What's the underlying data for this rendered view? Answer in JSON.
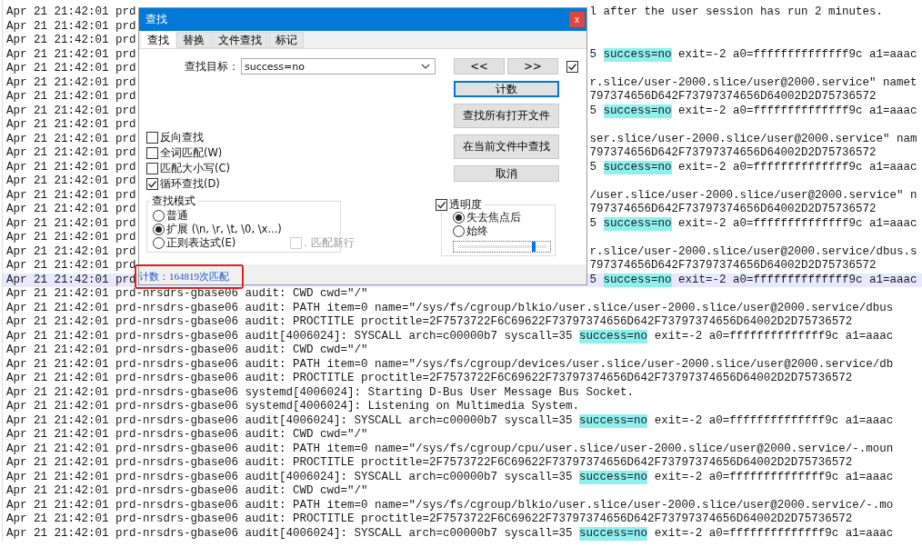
{
  "log_lines": [
    {
      "start": [
        {
          "text": "Apr 21 21:42:01 prd",
          "match": false
        }
      ],
      "end": [
        {
          "text": "l after the user session has run 2 minutes.",
          "match": false
        }
      ],
      "current": false
    },
    {
      "start": [
        {
          "text": "Apr 21 21:42:01 prd",
          "match": false
        }
      ],
      "current": false
    },
    {
      "start": [
        {
          "text": "Apr 21 21:42:01 prd",
          "match": false
        }
      ],
      "current": false
    },
    {
      "start": [
        {
          "text": "Apr 21 21:42:01 prd",
          "match": false
        }
      ],
      "end": [
        {
          "text": "5 ",
          "match": false
        },
        {
          "text": "success=no",
          "match": true
        },
        {
          "text": " exit=-2 a0=ffffffffffffff9c a1=aaac",
          "match": false
        }
      ],
      "current": false
    },
    {
      "start": [
        {
          "text": "Apr 21 21:42:01 prd",
          "match": false
        }
      ],
      "current": false
    },
    {
      "start": [
        {
          "text": "Apr 21 21:42:01 prd",
          "match": false
        }
      ],
      "end": [
        {
          "text": "r.slice/user-2000.slice/user@2000.service\" namet",
          "match": false
        }
      ],
      "current": false
    },
    {
      "start": [
        {
          "text": "Apr 21 21:42:01 prd",
          "match": false
        }
      ],
      "end": [
        {
          "text": "797374656D642F73797374656D64002D2D75736572",
          "match": false
        }
      ],
      "current": false
    },
    {
      "start": [
        {
          "text": "Apr 21 21:42:01 prd",
          "match": false
        }
      ],
      "end": [
        {
          "text": "5 ",
          "match": false
        },
        {
          "text": "success=no",
          "match": true
        },
        {
          "text": " exit=-2 a0=ffffffffffffff9c a1=aaac",
          "match": false
        }
      ],
      "current": false
    },
    {
      "start": [
        {
          "text": "Apr 21 21:42:01 prd",
          "match": false
        }
      ],
      "current": false
    },
    {
      "start": [
        {
          "text": "Apr 21 21:42:01 prd",
          "match": false
        }
      ],
      "end": [
        {
          "text": "ser.slice/user-2000.slice/user@2000.service\" nam",
          "match": false
        }
      ],
      "current": false
    },
    {
      "start": [
        {
          "text": "Apr 21 21:42:01 prd",
          "match": false
        }
      ],
      "end": [
        {
          "text": "797374656D642F73797374656D64002D2D75736572",
          "match": false
        }
      ],
      "current": false
    },
    {
      "start": [
        {
          "text": "Apr 21 21:42:01 prd",
          "match": false
        }
      ],
      "end": [
        {
          "text": "5 ",
          "match": false
        },
        {
          "text": "success=no",
          "match": true
        },
        {
          "text": " exit=-2 a0=ffffffffffffff9c a1=aaac",
          "match": false
        }
      ],
      "current": false
    },
    {
      "start": [
        {
          "text": "Apr 21 21:42:01 prd",
          "match": false
        }
      ],
      "current": false
    },
    {
      "start": [
        {
          "text": "Apr 21 21:42:01 prd",
          "match": false
        }
      ],
      "end": [
        {
          "text": "/user.slice/user-2000.slice/user@2000.service\" n",
          "match": false
        }
      ],
      "current": false
    },
    {
      "start": [
        {
          "text": "Apr 21 21:42:01 prd",
          "match": false
        }
      ],
      "end": [
        {
          "text": "797374656D642F73797374656D64002D2D75736572",
          "match": false
        }
      ],
      "current": false
    },
    {
      "start": [
        {
          "text": "Apr 21 21:42:01 prd",
          "match": false
        }
      ],
      "end": [
        {
          "text": "5 ",
          "match": false
        },
        {
          "text": "success=no",
          "match": true
        },
        {
          "text": " exit=-2 a0=ffffffffffffff9c a1=aaac",
          "match": false
        }
      ],
      "current": false
    },
    {
      "start": [
        {
          "text": "Apr 21 21:42:01 prd",
          "match": false
        }
      ],
      "current": false
    },
    {
      "start": [
        {
          "text": "Apr 21 21:42:01 prd",
          "match": false
        }
      ],
      "end": [
        {
          "text": "r.slice/user-2000.slice/user@2000.service/dbus.s",
          "match": false
        }
      ],
      "current": false
    },
    {
      "start": [
        {
          "text": "Apr 21 21:42:01 prd",
          "match": false
        }
      ],
      "end": [
        {
          "text": "797374656D642F73797374656D64002D2D75736572",
          "match": false
        }
      ],
      "current": false
    },
    {
      "start": [
        {
          "text": "Apr 21 21:42:01 prd",
          "match": false
        }
      ],
      "end": [
        {
          "text": "5 ",
          "match": false
        },
        {
          "text": "success=no",
          "match": true
        },
        {
          "text": " exit=-2 a0=ffffffffffffff9c a1=aaac",
          "match": false
        }
      ],
      "current": true
    },
    {
      "start": [
        {
          "text": "Apr 21 21:42:01 prd-nrsdrs-gbase06 audit: CWD cwd=\"/\"",
          "match": false
        }
      ],
      "current": false
    },
    {
      "start": [
        {
          "text": "Apr 21 21:42:01 prd-nrsdrs-gbase06 audit: PATH item=0 name=\"/sys/fs/cgroup/blkio/user.slice/user-2000.slice/user@2000.service/dbus",
          "match": false
        }
      ],
      "current": false
    },
    {
      "start": [
        {
          "text": "Apr 21 21:42:01 prd-nrsdrs-gbase06 audit: PROCTITLE proctitle=2F7573722F6C69622F73797374656D642F73797374656D64002D2D75736572",
          "match": false
        }
      ],
      "current": false
    },
    {
      "start": [
        {
          "text": "Apr 21 21:42:01 prd-nrsdrs-gbase06 audit[4006024]: SYSCALL arch=c00000b7 syscall=35 ",
          "match": false
        },
        {
          "text": "success=no",
          "match": true
        },
        {
          "text": " exit=-2 a0=ffffffffffffff9c a1=aaac",
          "match": false
        }
      ],
      "current": false
    },
    {
      "start": [
        {
          "text": "Apr 21 21:42:01 prd-nrsdrs-gbase06 audit: CWD cwd=\"/\"",
          "match": false
        }
      ],
      "current": false
    },
    {
      "start": [
        {
          "text": "Apr 21 21:42:01 prd-nrsdrs-gbase06 audit: PATH item=0 name=\"/sys/fs/cgroup/devices/user.slice/user-2000.slice/user@2000.service/db",
          "match": false
        }
      ],
      "current": false
    },
    {
      "start": [
        {
          "text": "Apr 21 21:42:01 prd-nrsdrs-gbase06 audit: PROCTITLE proctitle=2F7573722F6C69622F73797374656D642F73797374656D64002D2D75736572",
          "match": false
        }
      ],
      "current": false
    },
    {
      "start": [
        {
          "text": "Apr 21 21:42:01 prd-nrsdrs-gbase06 systemd[4006024]: Starting D-Bus User Message Bus Socket.",
          "match": false
        }
      ],
      "current": false
    },
    {
      "start": [
        {
          "text": "Apr 21 21:42:01 prd-nrsdrs-gbase06 systemd[4006024]: Listening on Multimedia System.",
          "match": false
        }
      ],
      "current": false
    },
    {
      "start": [
        {
          "text": "Apr 21 21:42:01 prd-nrsdrs-gbase06 audit[4006024]: SYSCALL arch=c00000b7 syscall=35 ",
          "match": false
        },
        {
          "text": "success=no",
          "match": true
        },
        {
          "text": " exit=-2 a0=ffffffffffffff9c a1=aaac",
          "match": false
        }
      ],
      "current": false
    },
    {
      "start": [
        {
          "text": "Apr 21 21:42:01 prd-nrsdrs-gbase06 audit: CWD cwd=\"/\"",
          "match": false
        }
      ],
      "current": false
    },
    {
      "start": [
        {
          "text": "Apr 21 21:42:01 prd-nrsdrs-gbase06 audit: PATH item=0 name=\"/sys/fs/cgroup/cpu/user.slice/user-2000.slice/user@2000.service/-.moun",
          "match": false
        }
      ],
      "current": false
    },
    {
      "start": [
        {
          "text": "Apr 21 21:42:01 prd-nrsdrs-gbase06 audit: PROCTITLE proctitle=2F7573722F6C69622F73797374656D642F73797374656D64002D2D75736572",
          "match": false
        }
      ],
      "current": false
    },
    {
      "start": [
        {
          "text": "Apr 21 21:42:01 prd-nrsdrs-gbase06 audit[4006024]: SYSCALL arch=c00000b7 syscall=35 ",
          "match": false
        },
        {
          "text": "success=no",
          "match": true
        },
        {
          "text": " exit=-2 a0=ffffffffffffff9c a1=aaac",
          "match": false
        }
      ],
      "current": false
    },
    {
      "start": [
        {
          "text": "Apr 21 21:42:01 prd-nrsdrs-gbase06 audit: CWD cwd=\"/\"",
          "match": false
        }
      ],
      "current": false
    },
    {
      "start": [
        {
          "text": "Apr 21 21:42:01 prd-nrsdrs-gbase06 audit: PATH item=0 name=\"/sys/fs/cgroup/blkio/user.slice/user-2000.slice/user@2000.service/-.mo",
          "match": false
        }
      ],
      "current": false
    },
    {
      "start": [
        {
          "text": "Apr 21 21:42:01 prd-nrsdrs-gbase06 audit: PROCTITLE proctitle=2F7573722F6C69622F73797374656D642F73797374656D64002D2D75736572",
          "match": false
        }
      ],
      "current": false
    },
    {
      "start": [
        {
          "text": "Apr 21 21:42:01 prd-nrsdrs-gbase06 audit[4006024]: SYSCALL arch=c00000b7 syscall=35 ",
          "match": false
        },
        {
          "text": "success=no",
          "match": true
        },
        {
          "text": " exit=-2 a0=ffffffffffffff9c a1=aaac",
          "match": false
        }
      ],
      "current": false
    }
  ],
  "dialog": {
    "title": "查找",
    "close": "x",
    "tabs": [
      {
        "label": "查找",
        "selected": true
      },
      {
        "label": "替换",
        "selected": false
      },
      {
        "label": "文件查找",
        "selected": false
      },
      {
        "label": "标记",
        "selected": false
      }
    ],
    "search": {
      "label": "查找目标：",
      "value": "success=no"
    },
    "nav_buttons": [
      "<<",
      ">>"
    ],
    "nav_checkbox": {
      "checked": true
    },
    "buttons": [
      {
        "label": "计数",
        "default": true
      },
      {
        "label": "查找所有打开文件",
        "default": false
      },
      {
        "label": "在当前文件中查找",
        "default": false
      },
      {
        "label": "取消",
        "default": false
      }
    ],
    "options": [
      {
        "label": "反向查找",
        "checked": false
      },
      {
        "label": "全词匹配(W)",
        "checked": false
      },
      {
        "label": "匹配大小写(C)",
        "checked": false
      },
      {
        "label": "循环查找(D)",
        "checked": true
      }
    ],
    "mode": {
      "title": "查找模式",
      "radios": [
        {
          "label": "普通",
          "selected": false
        },
        {
          "label": "扩展 (\\n, \\r, \\t, \\0, \\x...)",
          "selected": true
        },
        {
          "label": "正则表达式(E)",
          "selected": false
        }
      ],
      "newline": {
        "label": ". 匹配新行",
        "checked": false,
        "disabled": true
      }
    },
    "transparency": {
      "label": "透明度",
      "checked": true,
      "radios": [
        {
          "label": "失去焦点后",
          "selected": true
        },
        {
          "label": "始终",
          "selected": false
        }
      ],
      "level": 0.86
    },
    "status": "计数：164819次匹配"
  }
}
